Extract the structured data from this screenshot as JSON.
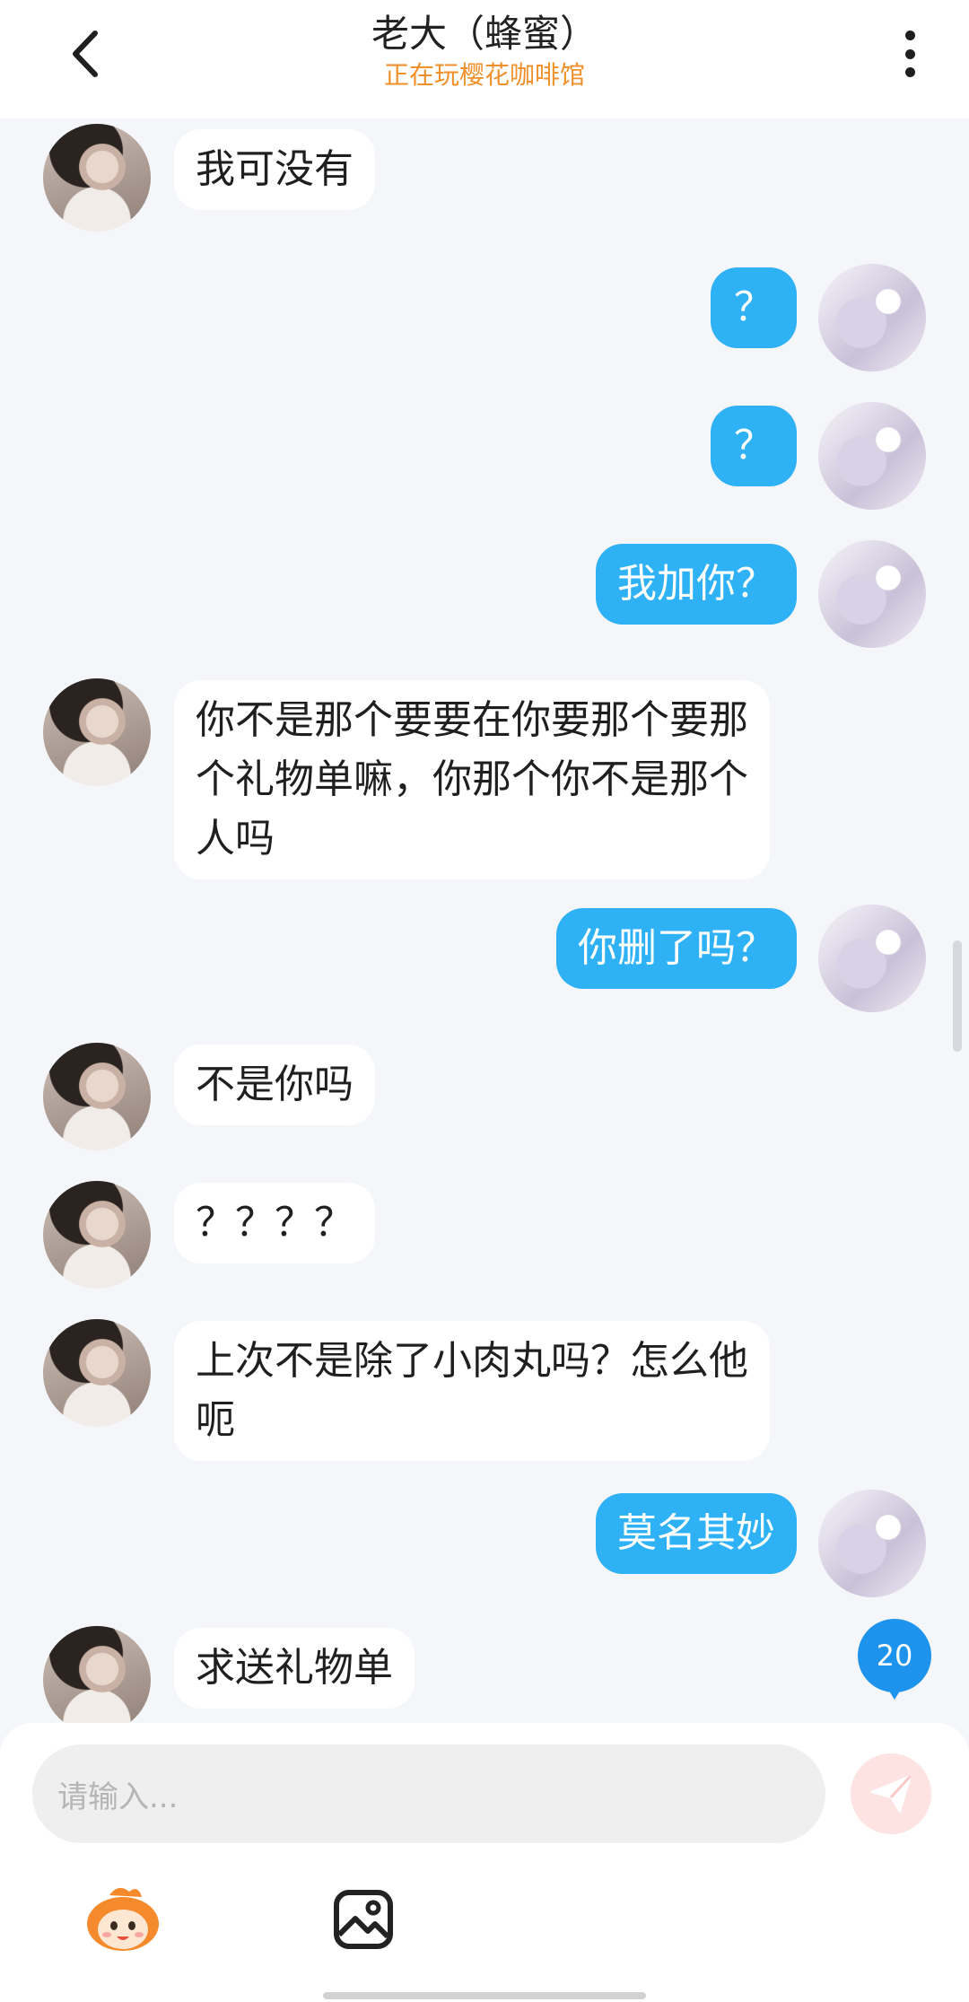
{
  "header": {
    "title": "老大（蜂蜜）",
    "subtitle": "正在玩樱花咖啡馆",
    "back_icon": "chevron-left-icon",
    "more_icon": "more-vertical-icon"
  },
  "messages": [
    {
      "sender": "them",
      "text": "我可没有"
    },
    {
      "sender": "me",
      "text": "？"
    },
    {
      "sender": "me",
      "text": "？"
    },
    {
      "sender": "me",
      "text": "我加你？"
    },
    {
      "sender": "them",
      "text": "你不是那个要要在你要那个要那\n个礼物单嘛，你那个你不是那个\n人吗"
    },
    {
      "sender": "me",
      "text": "你删了吗？"
    },
    {
      "sender": "them",
      "text": "不是你吗"
    },
    {
      "sender": "them",
      "text": "？？？？"
    },
    {
      "sender": "them",
      "text": "上次不是除了小肉丸吗？怎么他\n呃"
    },
    {
      "sender": "me",
      "text": "莫名其妙"
    },
    {
      "sender": "them",
      "text": "求送礼物单"
    }
  ],
  "unread_count": "20",
  "input": {
    "placeholder": "请输入..."
  },
  "toolbar": {
    "send_icon": "send-plane-icon",
    "emoji_icon": "mascot-emoji-icon",
    "image_icon": "image-icon"
  },
  "colors": {
    "my_bubble": "#2fb2f5",
    "their_bubble": "#ffffff",
    "background": "#f4f6f9",
    "subtitle": "#f0902a",
    "badge": "#1e93ee"
  }
}
